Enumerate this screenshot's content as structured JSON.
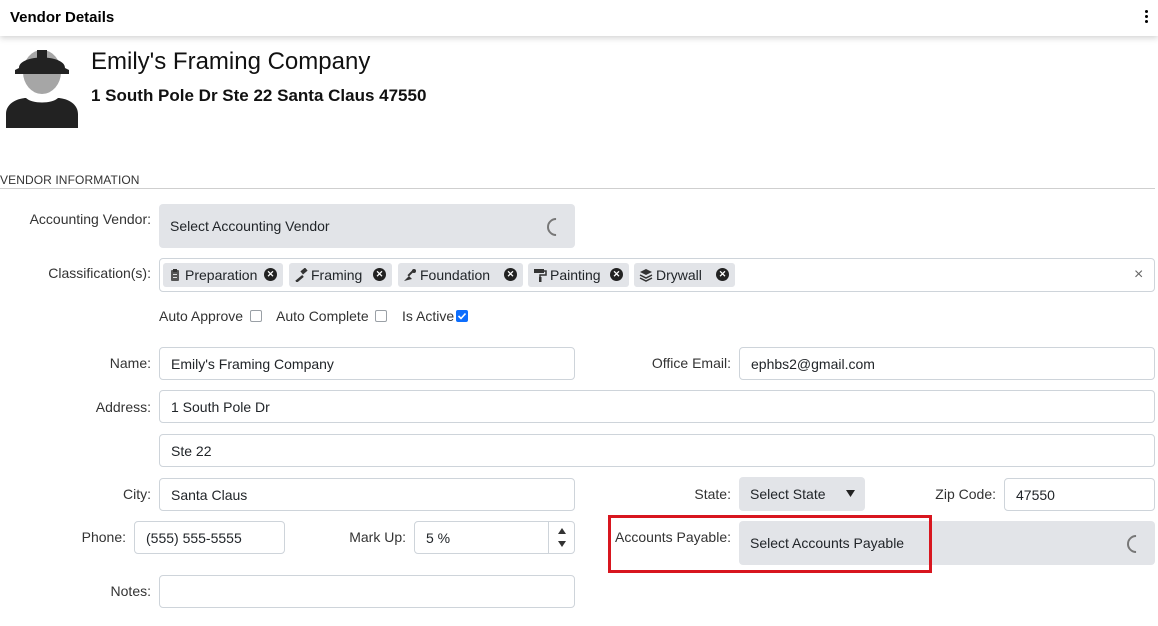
{
  "header": {
    "title": "Vendor Details"
  },
  "vendor": {
    "name": "Emily's Framing Company",
    "address_line": "1 South Pole Dr Ste 22 Santa Claus 47550"
  },
  "section": {
    "title": "VENDOR INFORMATION"
  },
  "accounting_vendor": {
    "label": "Accounting Vendor:",
    "placeholder": "Select Accounting Vendor"
  },
  "classifications": {
    "label": "Classification(s):",
    "items": [
      "Preparation",
      "Framing",
      "Foundation",
      "Painting",
      "Drywall"
    ],
    "clear": "×"
  },
  "checkboxes": [
    {
      "label": "Auto Approve",
      "checked": false
    },
    {
      "label": "Auto Complete",
      "checked": false
    },
    {
      "label": "Is Active",
      "checked": true
    }
  ],
  "name_field": {
    "label": "Name:",
    "value": "Emily's Framing Company"
  },
  "office_email": {
    "label": "Office Email:",
    "value": "ephbs2@gmail.com"
  },
  "address": {
    "label": "Address:",
    "line1": "1 South Pole Dr",
    "line2": "Ste 22"
  },
  "city": {
    "label": "City:",
    "value": "Santa Claus"
  },
  "state": {
    "label": "State:",
    "value": "Select State"
  },
  "zip": {
    "label": "Zip Code:",
    "value": "47550"
  },
  "phone": {
    "label": "Phone:",
    "value": "(555) 555-5555"
  },
  "markup": {
    "label": "Mark Up:",
    "value": "5 %"
  },
  "accounts_payable": {
    "label": "Accounts Payable:",
    "placeholder": "Select Accounts Payable"
  },
  "notes": {
    "label": "Notes:",
    "value": ""
  },
  "colors": {
    "highlight": "#d8161f",
    "checkbox_active": "#0d6efd",
    "select_bg": "#e2e4e8"
  },
  "icons": [
    "worker-avatar-icon",
    "clipboard-icon",
    "hammer-icon",
    "trowel-icon",
    "paint-roller-icon",
    "layers-icon",
    "chevron-down-icon",
    "loading-spinner-icon",
    "kebab-menu-icon"
  ]
}
